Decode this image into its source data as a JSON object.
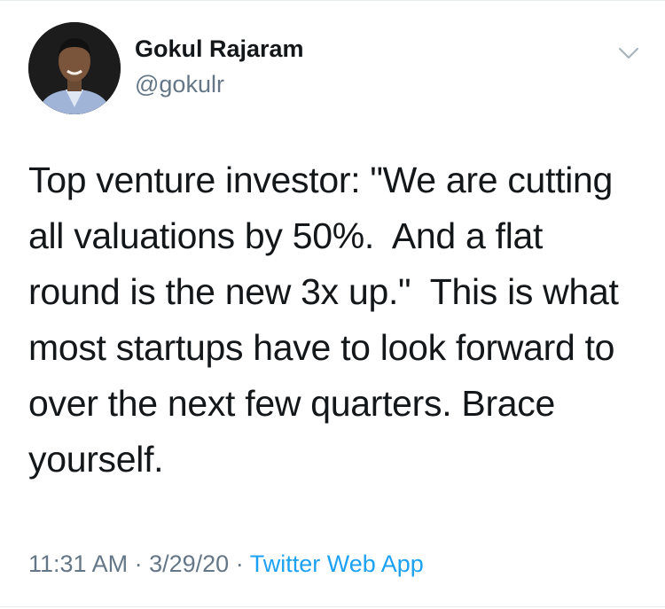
{
  "author": {
    "name": "Gokul Rajaram",
    "handle": "@gokulr"
  },
  "tweet": {
    "text": "Top venture investor: \"We are cutting\nall valuations by 50%.  And a flat\nround is the new 3x up.\"  This is what\nmost startups have to look forward to\nover the next few quarters. Brace\nyourself."
  },
  "meta": {
    "time": "11:31 AM",
    "date": "3/29/20",
    "separator": "·",
    "source": "Twitter Web App"
  },
  "icons": {
    "menu": "chevron-down-icon",
    "avatar": "profile-photo"
  },
  "colors": {
    "text": "#14171a",
    "secondary": "#657786",
    "link": "#1da1f2"
  }
}
